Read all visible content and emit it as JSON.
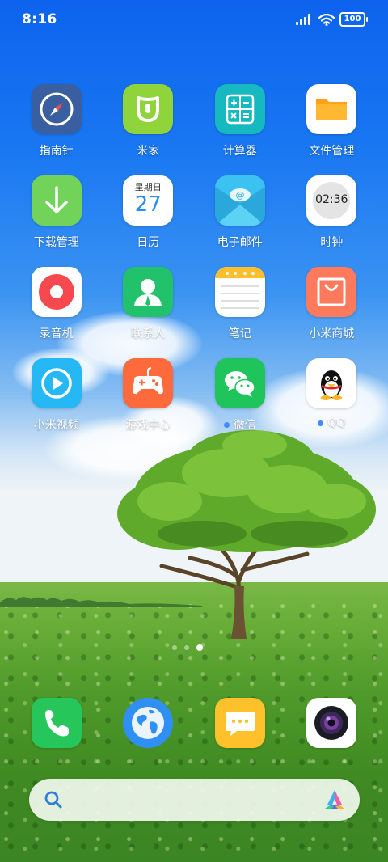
{
  "status_bar": {
    "time": "8:16",
    "battery": "100",
    "icons": [
      "signal-icon",
      "wifi-icon",
      "battery-icon"
    ]
  },
  "apps": [
    {
      "label": "指南针",
      "icon": "compass-icon",
      "color": "#3a5fa0"
    },
    {
      "label": "米家",
      "icon": "mijia-icon",
      "color": "#8fd43a"
    },
    {
      "label": "计算器",
      "icon": "calculator-icon",
      "color": "#16b9c0"
    },
    {
      "label": "文件管理",
      "icon": "folder-icon",
      "color": "#ffffff"
    },
    {
      "label": "下载管理",
      "icon": "download-icon",
      "color": "#72d35a"
    },
    {
      "label": "日历",
      "icon": "calendar-icon",
      "color": "#ffffff",
      "calendar_weekday": "星期日",
      "calendar_day": "27"
    },
    {
      "label": "电子邮件",
      "icon": "email-icon",
      "color": "#3cc2f0"
    },
    {
      "label": "时钟",
      "icon": "clock-icon",
      "color": "#ffffff",
      "clock_time": "02:36"
    },
    {
      "label": "录音机",
      "icon": "recorder-icon",
      "color": "#ffffff"
    },
    {
      "label": "联系人",
      "icon": "contacts-icon",
      "color": "#21c26b"
    },
    {
      "label": "笔记",
      "icon": "notes-icon",
      "color": "#ffffff"
    },
    {
      "label": "小米商城",
      "icon": "mi-store-icon",
      "color": "#ff7a5c"
    },
    {
      "label": "小米视频",
      "icon": "video-icon",
      "color": "#25b8f5"
    },
    {
      "label": "游戏中心",
      "icon": "game-center-icon",
      "color": "#ff6a3d"
    },
    {
      "label": "微信",
      "icon": "wechat-icon",
      "color": "#1fc45a",
      "new_dot": true
    },
    {
      "label": "QQ",
      "icon": "qq-icon",
      "color": "#ffffff",
      "new_dot": true
    }
  ],
  "page_indicator": {
    "pages": 3,
    "active": 3
  },
  "dock": [
    {
      "name": "phone",
      "icon": "phone-icon",
      "color": "#26c65a"
    },
    {
      "name": "browser",
      "icon": "browser-globe-icon",
      "color": "#2f8ff5"
    },
    {
      "name": "messages",
      "icon": "messages-icon",
      "color": "#ffc12b"
    },
    {
      "name": "camera",
      "icon": "camera-icon",
      "color": "#ffffff"
    }
  ],
  "search_bar": {
    "icons": [
      "search-icon",
      "xiaoai-assistant-icon"
    ]
  }
}
